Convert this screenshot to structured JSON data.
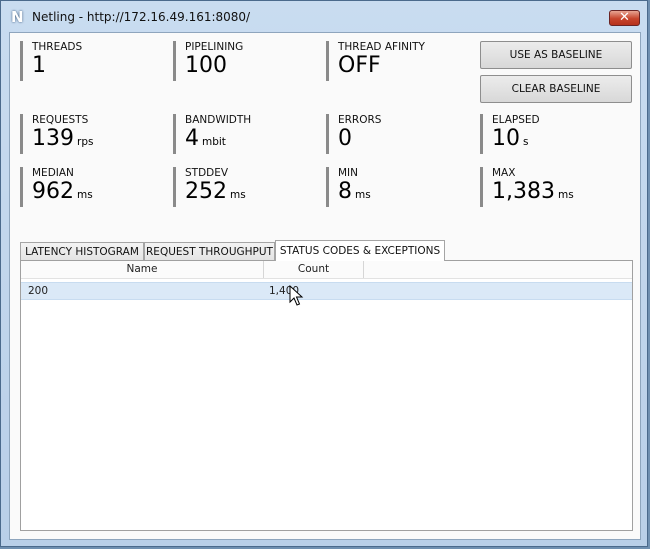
{
  "window": {
    "title": "Netling - http://172.16.49.161:8080/",
    "app_icon_glyph": "N",
    "close_glyph": "✕",
    "accent": "#b9cfe8"
  },
  "stats": {
    "threads": {
      "label": "THREADS",
      "value": "1",
      "unit": ""
    },
    "pipelining": {
      "label": "PIPELINING",
      "value": "100",
      "unit": ""
    },
    "thread_affinity": {
      "label": "THREAD AFINITY",
      "value": "OFF",
      "unit": ""
    },
    "requests": {
      "label": "REQUESTS",
      "value": "139",
      "unit": "rps"
    },
    "bandwidth": {
      "label": "BANDWIDTH",
      "value": "4",
      "unit": "mbit"
    },
    "errors": {
      "label": "ERRORS",
      "value": "0",
      "unit": ""
    },
    "elapsed": {
      "label": "ELAPSED",
      "value": "10",
      "unit": "s"
    },
    "median": {
      "label": "MEDIAN",
      "value": "962",
      "unit": "ms"
    },
    "stddev": {
      "label": "STDDEV",
      "value": "252",
      "unit": "ms"
    },
    "min": {
      "label": "MIN",
      "value": "8",
      "unit": "ms"
    },
    "max": {
      "label": "MAX",
      "value": "1,383",
      "unit": "ms"
    }
  },
  "buttons": {
    "use_as_baseline": "USE AS BASELINE",
    "clear_baseline": "CLEAR BASELINE"
  },
  "tabs": [
    {
      "label": "LATENCY HISTOGRAM",
      "active": false
    },
    {
      "label": "REQUEST THROUGHPUT",
      "active": false
    },
    {
      "label": "STATUS CODES & EXCEPTIONS",
      "active": true
    }
  ],
  "grid": {
    "columns": [
      "Name",
      "Count"
    ],
    "rows": [
      {
        "name": "200",
        "count": "1,400",
        "selected": true
      }
    ]
  }
}
